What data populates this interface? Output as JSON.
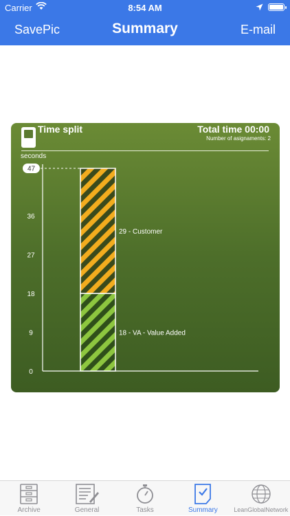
{
  "status_bar": {
    "carrier": "Carrier",
    "time": "8:54 AM"
  },
  "nav": {
    "left_label": "SavePic",
    "title": "Summary",
    "right_label": "E-mail"
  },
  "card": {
    "title": "Time split",
    "total_time": "Total time 00:00",
    "assignments": "Number of asignaments: 2",
    "unit_label": "seconds"
  },
  "chart_data": {
    "type": "bar",
    "stacked": true,
    "categories": [
      ""
    ],
    "ylim": [
      0,
      47
    ],
    "yticks": [
      0,
      9,
      18,
      27,
      36,
      47
    ],
    "highlight_tick": 47,
    "series": [
      {
        "name": "VA - Value Added",
        "values": [
          18
        ],
        "label": "18 - VA - Value Added",
        "color": "#8dc63f"
      },
      {
        "name": "Customer",
        "values": [
          29
        ],
        "label": "29 - Customer",
        "color": "#f2ac1e"
      }
    ]
  },
  "tabs": [
    {
      "label": "Archive",
      "icon": "cabinet-icon",
      "active": false
    },
    {
      "label": "General",
      "icon": "form-icon",
      "active": false
    },
    {
      "label": "Tasks",
      "icon": "stopwatch-icon",
      "active": false
    },
    {
      "label": "Summary",
      "icon": "summary-icon",
      "active": true
    },
    {
      "label": "LeanGlobalNetwork",
      "icon": "globe-icon",
      "active": false
    }
  ],
  "colors": {
    "accent": "#3b78e7",
    "tab_inactive": "#8e8e93",
    "card_top": "#6b8b35",
    "card_bottom": "#3d5c22"
  }
}
